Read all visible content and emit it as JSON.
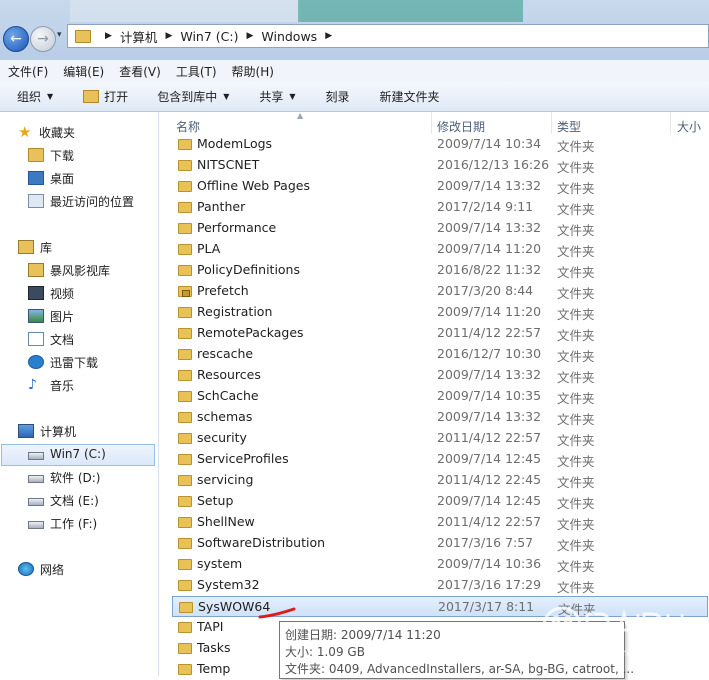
{
  "nav": {
    "back_glyph": "←",
    "forward_glyph": "→",
    "recent_glyph": "▾"
  },
  "address": {
    "crumbs": [
      "计算机",
      "Win7 (C:)",
      "Windows"
    ],
    "separator": "▶"
  },
  "menu": [
    "文件(F)",
    "编辑(E)",
    "查看(V)",
    "工具(T)",
    "帮助(H)"
  ],
  "toolbar": {
    "organize": "组织",
    "open": "打开",
    "include_library": "包含到库中",
    "share": "共享",
    "burn": "刻录",
    "new_folder": "新建文件夹",
    "dropdown_glyph": "▼"
  },
  "sidebar": {
    "favorites": {
      "label": "收藏夹",
      "items": [
        "下载",
        "桌面",
        "最近访问的位置"
      ]
    },
    "libraries": {
      "label": "库",
      "items": [
        "暴风影视库",
        "视频",
        "图片",
        "文档",
        "迅雷下载",
        "音乐"
      ]
    },
    "computer": {
      "label": "计算机",
      "items": [
        "Win7 (C:)",
        "软件 (D:)",
        "文档 (E:)",
        "工作 (F:)"
      ],
      "selected": "Win7 (C:)"
    },
    "network": {
      "label": "网络"
    }
  },
  "columns": {
    "name": "名称",
    "modified": "修改日期",
    "type": "类型",
    "size": "大小"
  },
  "files": [
    {
      "name": "ModemLogs",
      "date": "2009/7/14 10:34",
      "type": "文件夹"
    },
    {
      "name": "NITSCNET",
      "date": "2016/12/13 16:26",
      "type": "文件夹"
    },
    {
      "name": "Offline Web Pages",
      "date": "2009/7/14 13:32",
      "type": "文件夹"
    },
    {
      "name": "Panther",
      "date": "2017/2/14 9:11",
      "type": "文件夹"
    },
    {
      "name": "Performance",
      "date": "2009/7/14 13:32",
      "type": "文件夹"
    },
    {
      "name": "PLA",
      "date": "2009/7/14 11:20",
      "type": "文件夹"
    },
    {
      "name": "PolicyDefinitions",
      "date": "2016/8/22 11:32",
      "type": "文件夹"
    },
    {
      "name": "Prefetch",
      "date": "2017/3/20 8:44",
      "type": "文件夹",
      "locked": true
    },
    {
      "name": "Registration",
      "date": "2009/7/14 11:20",
      "type": "文件夹"
    },
    {
      "name": "RemotePackages",
      "date": "2011/4/12 22:57",
      "type": "文件夹"
    },
    {
      "name": "rescache",
      "date": "2016/12/7 10:30",
      "type": "文件夹"
    },
    {
      "name": "Resources",
      "date": "2009/7/14 13:32",
      "type": "文件夹"
    },
    {
      "name": "SchCache",
      "date": "2009/7/14 10:35",
      "type": "文件夹"
    },
    {
      "name": "schemas",
      "date": "2009/7/14 13:32",
      "type": "文件夹"
    },
    {
      "name": "security",
      "date": "2011/4/12 22:57",
      "type": "文件夹"
    },
    {
      "name": "ServiceProfiles",
      "date": "2009/7/14 12:45",
      "type": "文件夹"
    },
    {
      "name": "servicing",
      "date": "2011/4/12 22:45",
      "type": "文件夹"
    },
    {
      "name": "Setup",
      "date": "2009/7/14 12:45",
      "type": "文件夹"
    },
    {
      "name": "ShellNew",
      "date": "2011/4/12 22:57",
      "type": "文件夹"
    },
    {
      "name": "SoftwareDistribution",
      "date": "2017/3/16 7:57",
      "type": "文件夹"
    },
    {
      "name": "system",
      "date": "2009/7/14 10:36",
      "type": "文件夹"
    },
    {
      "name": "System32",
      "date": "2017/3/16 17:29",
      "type": "文件夹"
    },
    {
      "name": "SysWOW64",
      "date": "2017/3/17 8:11",
      "type": "文件夹",
      "selected": true
    },
    {
      "name": "TAPI",
      "date": "",
      "type": ""
    },
    {
      "name": "Tasks",
      "date": "",
      "type": ""
    },
    {
      "name": "Temp",
      "date": "",
      "type": ""
    }
  ],
  "tooltip": {
    "created": "创建日期: 2009/7/14 11:20",
    "size": "大小: 1.09 GB",
    "contents": "文件夹: 0409, AdvancedInstallers, ar-SA, bg-BG, catroot, ..."
  },
  "colors": {
    "selection_bg": "#cfe2f9",
    "selection_border": "#7da2ce",
    "annotation_red": "#e01b1b",
    "folder": "#e9c257"
  }
}
